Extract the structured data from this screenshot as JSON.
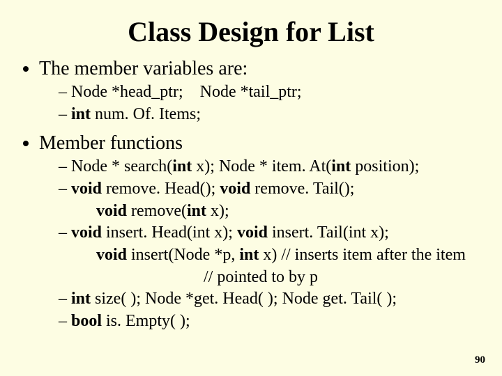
{
  "title": "Class Design for List",
  "bullets": {
    "memberVarsLabel": "The member variables are:",
    "vars": {
      "line1_a": "Node *head_ptr;",
      "line1_b": "Node *tail_ptr;",
      "line2_kw": "int",
      "line2_rest": " num. Of. Items;"
    },
    "memberFuncsLabel": "Member functions",
    "funcs": {
      "f1_a": "Node * search(",
      "f1_kw1": "int",
      "f1_b": " x);   Node * item. At(",
      "f1_kw2": "int",
      "f1_c": " position);",
      "f2_kw1": "void",
      "f2_a": " remove. Head(); ",
      "f2_kw2": "void",
      "f2_b": " remove. Tail();",
      "f2c_kw": "void",
      "f2c_rest": " remove(",
      "f2c_kw2": "int",
      "f2c_end": " x);",
      "f3_kw1": "void",
      "f3_a": " insert. Head(int x); ",
      "f3_kw2": "void",
      "f3_b": " insert. Tail(int x);",
      "f3c_kw": "void",
      "f3c_a": " insert(Node *p, ",
      "f3c_kw2": "int",
      "f3c_b": " x) // inserts item after the item",
      "f3c_cont": "// pointed to by p",
      "f4_kw": "int",
      "f4_rest": " size( ); Node *get. Head( ); Node get. Tail( );",
      "f5_kw": "bool",
      "f5_rest": " is. Empty( );"
    }
  },
  "pageNumber": "90"
}
